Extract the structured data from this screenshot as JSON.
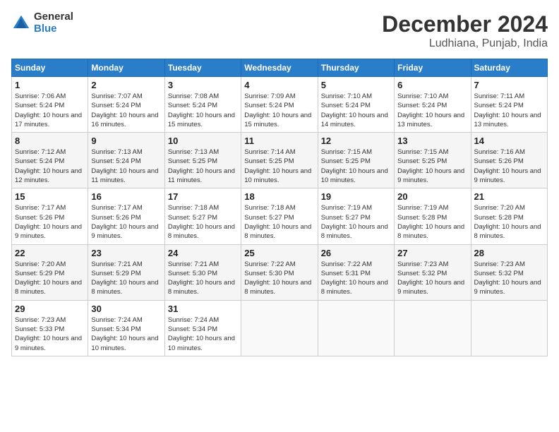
{
  "logo": {
    "general": "General",
    "blue": "Blue"
  },
  "header": {
    "month": "December 2024",
    "location": "Ludhiana, Punjab, India"
  },
  "weekdays": [
    "Sunday",
    "Monday",
    "Tuesday",
    "Wednesday",
    "Thursday",
    "Friday",
    "Saturday"
  ],
  "days": [
    {
      "date": "",
      "sunrise": "",
      "sunset": "",
      "daylight": ""
    },
    {
      "date": "",
      "sunrise": "",
      "sunset": "",
      "daylight": ""
    },
    {
      "date": "",
      "sunrise": "",
      "sunset": "",
      "daylight": ""
    },
    {
      "date": "1",
      "sunrise": "Sunrise: 7:06 AM",
      "sunset": "Sunset: 5:24 PM",
      "daylight": "Daylight: 10 hours and 17 minutes."
    },
    {
      "date": "2",
      "sunrise": "Sunrise: 7:07 AM",
      "sunset": "Sunset: 5:24 PM",
      "daylight": "Daylight: 10 hours and 16 minutes."
    },
    {
      "date": "3",
      "sunrise": "Sunrise: 7:08 AM",
      "sunset": "Sunset: 5:24 PM",
      "daylight": "Daylight: 10 hours and 15 minutes."
    },
    {
      "date": "4",
      "sunrise": "Sunrise: 7:09 AM",
      "sunset": "Sunset: 5:24 PM",
      "daylight": "Daylight: 10 hours and 15 minutes."
    },
    {
      "date": "5",
      "sunrise": "Sunrise: 7:10 AM",
      "sunset": "Sunset: 5:24 PM",
      "daylight": "Daylight: 10 hours and 14 minutes."
    },
    {
      "date": "6",
      "sunrise": "Sunrise: 7:10 AM",
      "sunset": "Sunset: 5:24 PM",
      "daylight": "Daylight: 10 hours and 13 minutes."
    },
    {
      "date": "7",
      "sunrise": "Sunrise: 7:11 AM",
      "sunset": "Sunset: 5:24 PM",
      "daylight": "Daylight: 10 hours and 13 minutes."
    },
    {
      "date": "8",
      "sunrise": "Sunrise: 7:12 AM",
      "sunset": "Sunset: 5:24 PM",
      "daylight": "Daylight: 10 hours and 12 minutes."
    },
    {
      "date": "9",
      "sunrise": "Sunrise: 7:13 AM",
      "sunset": "Sunset: 5:24 PM",
      "daylight": "Daylight: 10 hours and 11 minutes."
    },
    {
      "date": "10",
      "sunrise": "Sunrise: 7:13 AM",
      "sunset": "Sunset: 5:25 PM",
      "daylight": "Daylight: 10 hours and 11 minutes."
    },
    {
      "date": "11",
      "sunrise": "Sunrise: 7:14 AM",
      "sunset": "Sunset: 5:25 PM",
      "daylight": "Daylight: 10 hours and 10 minutes."
    },
    {
      "date": "12",
      "sunrise": "Sunrise: 7:15 AM",
      "sunset": "Sunset: 5:25 PM",
      "daylight": "Daylight: 10 hours and 10 minutes."
    },
    {
      "date": "13",
      "sunrise": "Sunrise: 7:15 AM",
      "sunset": "Sunset: 5:25 PM",
      "daylight": "Daylight: 10 hours and 9 minutes."
    },
    {
      "date": "14",
      "sunrise": "Sunrise: 7:16 AM",
      "sunset": "Sunset: 5:26 PM",
      "daylight": "Daylight: 10 hours and 9 minutes."
    },
    {
      "date": "15",
      "sunrise": "Sunrise: 7:17 AM",
      "sunset": "Sunset: 5:26 PM",
      "daylight": "Daylight: 10 hours and 9 minutes."
    },
    {
      "date": "16",
      "sunrise": "Sunrise: 7:17 AM",
      "sunset": "Sunset: 5:26 PM",
      "daylight": "Daylight: 10 hours and 9 minutes."
    },
    {
      "date": "17",
      "sunrise": "Sunrise: 7:18 AM",
      "sunset": "Sunset: 5:27 PM",
      "daylight": "Daylight: 10 hours and 8 minutes."
    },
    {
      "date": "18",
      "sunrise": "Sunrise: 7:18 AM",
      "sunset": "Sunset: 5:27 PM",
      "daylight": "Daylight: 10 hours and 8 minutes."
    },
    {
      "date": "19",
      "sunrise": "Sunrise: 7:19 AM",
      "sunset": "Sunset: 5:27 PM",
      "daylight": "Daylight: 10 hours and 8 minutes."
    },
    {
      "date": "20",
      "sunrise": "Sunrise: 7:19 AM",
      "sunset": "Sunset: 5:28 PM",
      "daylight": "Daylight: 10 hours and 8 minutes."
    },
    {
      "date": "21",
      "sunrise": "Sunrise: 7:20 AM",
      "sunset": "Sunset: 5:28 PM",
      "daylight": "Daylight: 10 hours and 8 minutes."
    },
    {
      "date": "22",
      "sunrise": "Sunrise: 7:20 AM",
      "sunset": "Sunset: 5:29 PM",
      "daylight": "Daylight: 10 hours and 8 minutes."
    },
    {
      "date": "23",
      "sunrise": "Sunrise: 7:21 AM",
      "sunset": "Sunset: 5:29 PM",
      "daylight": "Daylight: 10 hours and 8 minutes."
    },
    {
      "date": "24",
      "sunrise": "Sunrise: 7:21 AM",
      "sunset": "Sunset: 5:30 PM",
      "daylight": "Daylight: 10 hours and 8 minutes."
    },
    {
      "date": "25",
      "sunrise": "Sunrise: 7:22 AM",
      "sunset": "Sunset: 5:30 PM",
      "daylight": "Daylight: 10 hours and 8 minutes."
    },
    {
      "date": "26",
      "sunrise": "Sunrise: 7:22 AM",
      "sunset": "Sunset: 5:31 PM",
      "daylight": "Daylight: 10 hours and 8 minutes."
    },
    {
      "date": "27",
      "sunrise": "Sunrise: 7:23 AM",
      "sunset": "Sunset: 5:32 PM",
      "daylight": "Daylight: 10 hours and 9 minutes."
    },
    {
      "date": "28",
      "sunrise": "Sunrise: 7:23 AM",
      "sunset": "Sunset: 5:32 PM",
      "daylight": "Daylight: 10 hours and 9 minutes."
    },
    {
      "date": "29",
      "sunrise": "Sunrise: 7:23 AM",
      "sunset": "Sunset: 5:33 PM",
      "daylight": "Daylight: 10 hours and 9 minutes."
    },
    {
      "date": "30",
      "sunrise": "Sunrise: 7:24 AM",
      "sunset": "Sunset: 5:34 PM",
      "daylight": "Daylight: 10 hours and 10 minutes."
    },
    {
      "date": "31",
      "sunrise": "Sunrise: 7:24 AM",
      "sunset": "Sunset: 5:34 PM",
      "daylight": "Daylight: 10 hours and 10 minutes."
    },
    {
      "date": "",
      "sunrise": "",
      "sunset": "",
      "daylight": ""
    },
    {
      "date": "",
      "sunrise": "",
      "sunset": "",
      "daylight": ""
    }
  ]
}
